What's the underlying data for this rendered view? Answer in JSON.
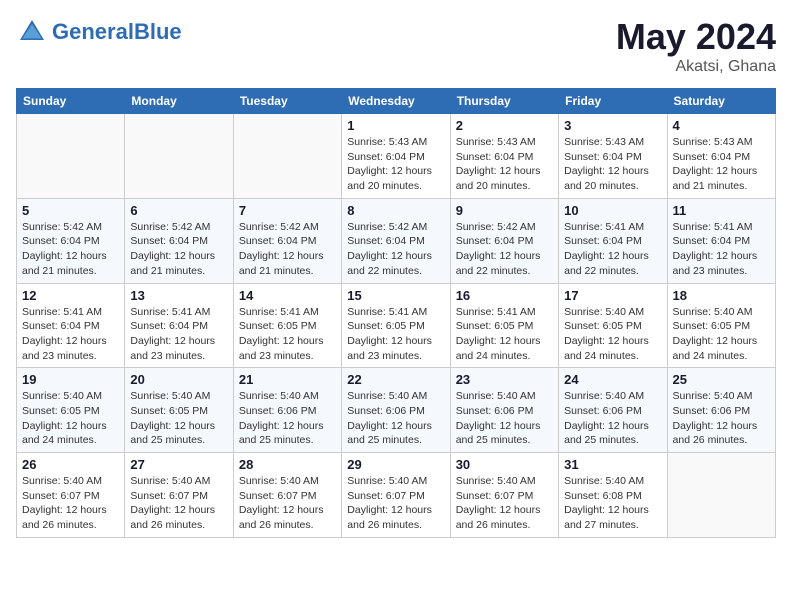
{
  "logo": {
    "text_general": "General",
    "text_blue": "Blue"
  },
  "title": {
    "month_year": "May 2024",
    "location": "Akatsi, Ghana"
  },
  "weekdays": [
    "Sunday",
    "Monday",
    "Tuesday",
    "Wednesday",
    "Thursday",
    "Friday",
    "Saturday"
  ],
  "weeks": [
    [
      {
        "day": "",
        "info": ""
      },
      {
        "day": "",
        "info": ""
      },
      {
        "day": "",
        "info": ""
      },
      {
        "day": "1",
        "info": "Sunrise: 5:43 AM\nSunset: 6:04 PM\nDaylight: 12 hours\nand 20 minutes."
      },
      {
        "day": "2",
        "info": "Sunrise: 5:43 AM\nSunset: 6:04 PM\nDaylight: 12 hours\nand 20 minutes."
      },
      {
        "day": "3",
        "info": "Sunrise: 5:43 AM\nSunset: 6:04 PM\nDaylight: 12 hours\nand 20 minutes."
      },
      {
        "day": "4",
        "info": "Sunrise: 5:43 AM\nSunset: 6:04 PM\nDaylight: 12 hours\nand 21 minutes."
      }
    ],
    [
      {
        "day": "5",
        "info": "Sunrise: 5:42 AM\nSunset: 6:04 PM\nDaylight: 12 hours\nand 21 minutes."
      },
      {
        "day": "6",
        "info": "Sunrise: 5:42 AM\nSunset: 6:04 PM\nDaylight: 12 hours\nand 21 minutes."
      },
      {
        "day": "7",
        "info": "Sunrise: 5:42 AM\nSunset: 6:04 PM\nDaylight: 12 hours\nand 21 minutes."
      },
      {
        "day": "8",
        "info": "Sunrise: 5:42 AM\nSunset: 6:04 PM\nDaylight: 12 hours\nand 22 minutes."
      },
      {
        "day": "9",
        "info": "Sunrise: 5:42 AM\nSunset: 6:04 PM\nDaylight: 12 hours\nand 22 minutes."
      },
      {
        "day": "10",
        "info": "Sunrise: 5:41 AM\nSunset: 6:04 PM\nDaylight: 12 hours\nand 22 minutes."
      },
      {
        "day": "11",
        "info": "Sunrise: 5:41 AM\nSunset: 6:04 PM\nDaylight: 12 hours\nand 23 minutes."
      }
    ],
    [
      {
        "day": "12",
        "info": "Sunrise: 5:41 AM\nSunset: 6:04 PM\nDaylight: 12 hours\nand 23 minutes."
      },
      {
        "day": "13",
        "info": "Sunrise: 5:41 AM\nSunset: 6:04 PM\nDaylight: 12 hours\nand 23 minutes."
      },
      {
        "day": "14",
        "info": "Sunrise: 5:41 AM\nSunset: 6:05 PM\nDaylight: 12 hours\nand 23 minutes."
      },
      {
        "day": "15",
        "info": "Sunrise: 5:41 AM\nSunset: 6:05 PM\nDaylight: 12 hours\nand 23 minutes."
      },
      {
        "day": "16",
        "info": "Sunrise: 5:41 AM\nSunset: 6:05 PM\nDaylight: 12 hours\nand 24 minutes."
      },
      {
        "day": "17",
        "info": "Sunrise: 5:40 AM\nSunset: 6:05 PM\nDaylight: 12 hours\nand 24 minutes."
      },
      {
        "day": "18",
        "info": "Sunrise: 5:40 AM\nSunset: 6:05 PM\nDaylight: 12 hours\nand 24 minutes."
      }
    ],
    [
      {
        "day": "19",
        "info": "Sunrise: 5:40 AM\nSunset: 6:05 PM\nDaylight: 12 hours\nand 24 minutes."
      },
      {
        "day": "20",
        "info": "Sunrise: 5:40 AM\nSunset: 6:05 PM\nDaylight: 12 hours\nand 25 minutes."
      },
      {
        "day": "21",
        "info": "Sunrise: 5:40 AM\nSunset: 6:06 PM\nDaylight: 12 hours\nand 25 minutes."
      },
      {
        "day": "22",
        "info": "Sunrise: 5:40 AM\nSunset: 6:06 PM\nDaylight: 12 hours\nand 25 minutes."
      },
      {
        "day": "23",
        "info": "Sunrise: 5:40 AM\nSunset: 6:06 PM\nDaylight: 12 hours\nand 25 minutes."
      },
      {
        "day": "24",
        "info": "Sunrise: 5:40 AM\nSunset: 6:06 PM\nDaylight: 12 hours\nand 25 minutes."
      },
      {
        "day": "25",
        "info": "Sunrise: 5:40 AM\nSunset: 6:06 PM\nDaylight: 12 hours\nand 26 minutes."
      }
    ],
    [
      {
        "day": "26",
        "info": "Sunrise: 5:40 AM\nSunset: 6:07 PM\nDaylight: 12 hours\nand 26 minutes."
      },
      {
        "day": "27",
        "info": "Sunrise: 5:40 AM\nSunset: 6:07 PM\nDaylight: 12 hours\nand 26 minutes."
      },
      {
        "day": "28",
        "info": "Sunrise: 5:40 AM\nSunset: 6:07 PM\nDaylight: 12 hours\nand 26 minutes."
      },
      {
        "day": "29",
        "info": "Sunrise: 5:40 AM\nSunset: 6:07 PM\nDaylight: 12 hours\nand 26 minutes."
      },
      {
        "day": "30",
        "info": "Sunrise: 5:40 AM\nSunset: 6:07 PM\nDaylight: 12 hours\nand 26 minutes."
      },
      {
        "day": "31",
        "info": "Sunrise: 5:40 AM\nSunset: 6:08 PM\nDaylight: 12 hours\nand 27 minutes."
      },
      {
        "day": "",
        "info": ""
      }
    ]
  ]
}
